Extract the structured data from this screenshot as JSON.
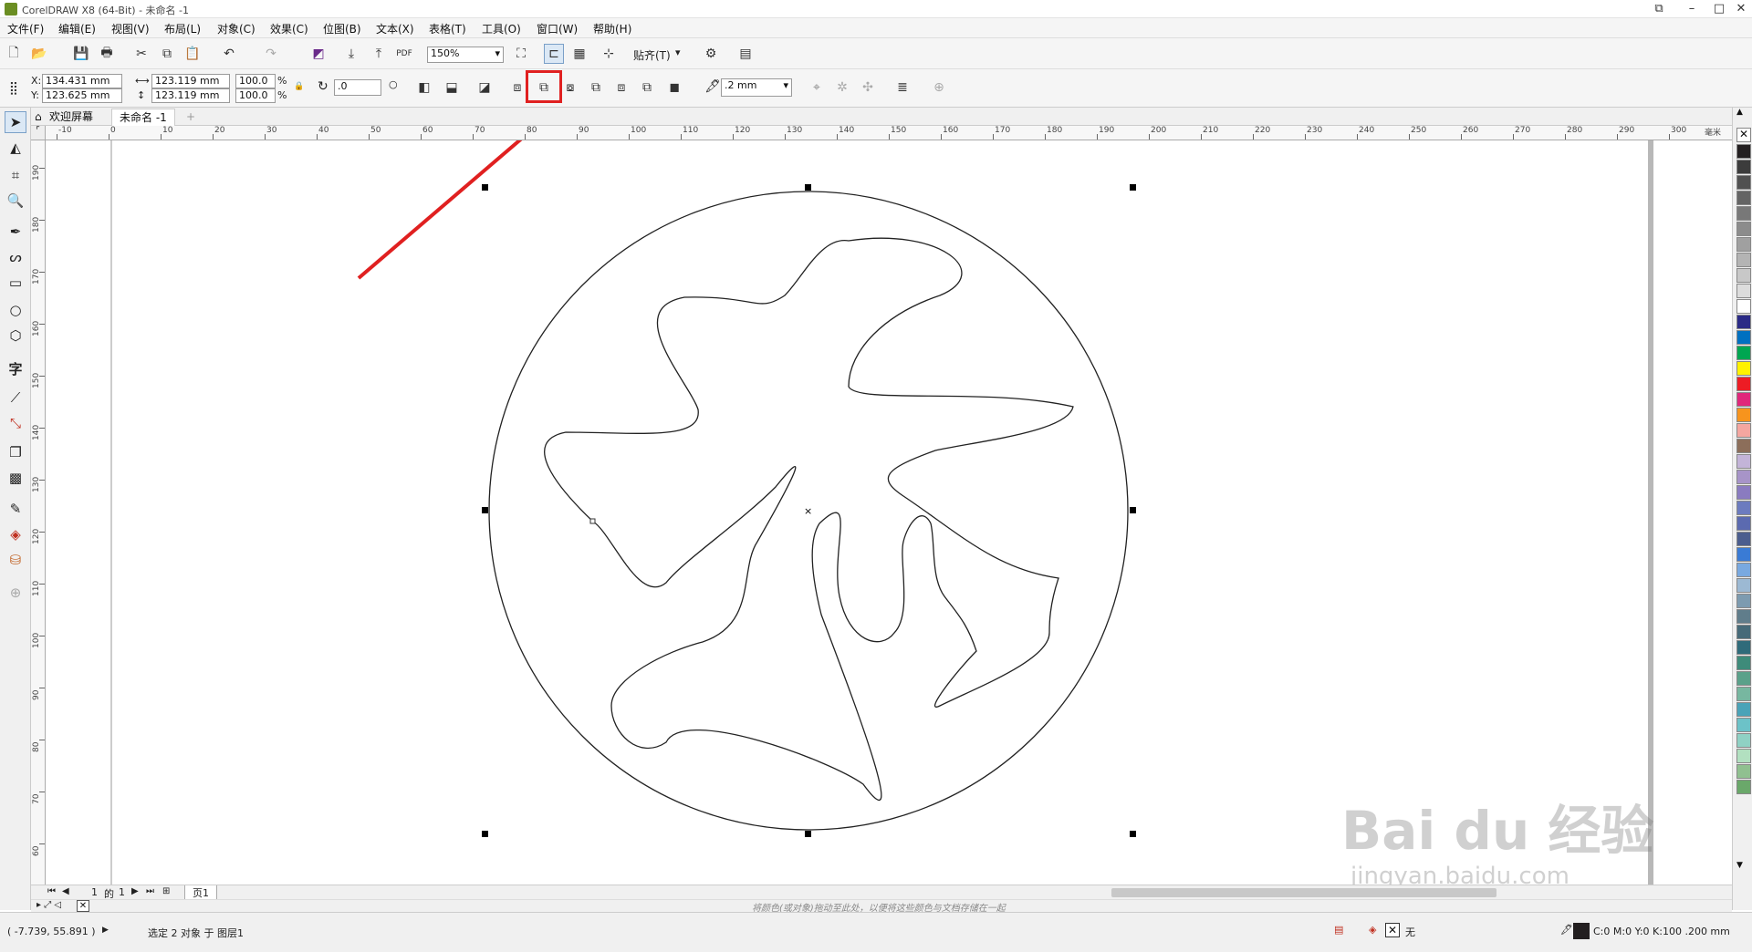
{
  "window": {
    "title": "CorelDRAW X8 (64-Bit) - 未命名 -1"
  },
  "menu": [
    "文件(F)",
    "编辑(E)",
    "视图(V)",
    "布局(L)",
    "对象(C)",
    "效果(C)",
    "位图(B)",
    "文本(X)",
    "表格(T)",
    "工具(O)",
    "窗口(W)",
    "帮助(H)"
  ],
  "toolbar": {
    "zoom": "150%",
    "snap_label": "贴齐(T)"
  },
  "props": {
    "x": "134.431 mm",
    "y": "123.625 mm",
    "width": "123.119 mm",
    "height": "123.119 mm",
    "scale_x": "100.0",
    "scale_y": "100.0",
    "percent": "%",
    "rotation": ".0",
    "outline_width": ".2 mm",
    "x_label": "X:",
    "y_label": "Y:"
  },
  "tabs": [
    {
      "label": "欢迎屏幕"
    },
    {
      "label": "未命名 -1"
    }
  ],
  "hruler": {
    "values": [
      "-10",
      "0",
      "10",
      "20",
      "30",
      "40",
      "50",
      "60",
      "70",
      "80",
      "90",
      "100",
      "110",
      "120",
      "130",
      "140",
      "150",
      "160",
      "170",
      "180",
      "190",
      "200",
      "210",
      "220",
      "230",
      "240",
      "250",
      "260",
      "270",
      "280",
      "290",
      "300"
    ],
    "unit": "毫米"
  },
  "vruler": {
    "values": [
      "190",
      "180",
      "170",
      "160",
      "150",
      "140",
      "130",
      "120",
      "110",
      "100",
      "90",
      "80",
      "70",
      "60"
    ]
  },
  "pagenav": {
    "current": "1",
    "of_label": "的",
    "total": "1",
    "page_tab": "页1"
  },
  "hint": "将颜色(或对象)拖动至此处，以便将这些颜色与文档存储在一起",
  "status": {
    "coords": "( -7.739, 55.891 )",
    "selection": "选定 2 对象 于 图层1",
    "fill_none": "无",
    "outline_info": "C:0 M:0 Y:0 K:100  .200 mm"
  },
  "watermark": {
    "brand": "Bai du 经验",
    "url": "jingyan.baidu.com"
  },
  "colors": {
    "highlight": "#e02020",
    "palette": [
      "#231f20",
      "#3c3c3c",
      "#505050",
      "#646464",
      "#787878",
      "#8c8c8c",
      "#a0a0a0",
      "#b4b4b4",
      "#c8c8c8",
      "#dcdcdc",
      "#ffffff",
      "#2a2a86",
      "#0070c0",
      "#00a651",
      "#fff200",
      "#ed1c24",
      "#e0277b",
      "#f7941d",
      "#f4a6a0",
      "#8c6e5a",
      "#c3b4d8",
      "#a794c8",
      "#8a7bc0",
      "#6c7bbf",
      "#5b6ab0",
      "#4b5d8e",
      "#3a7bd5",
      "#79a9e0",
      "#9cb9d3",
      "#7d9bb0",
      "#607d8b",
      "#466a78",
      "#2f6b7a",
      "#3e8b7a",
      "#5aa18a",
      "#77b7a0",
      "#4aa3b8",
      "#6cc2c8",
      "#8fd1c4",
      "#b2e0c0",
      "#90c090",
      "#6aa86a"
    ]
  }
}
